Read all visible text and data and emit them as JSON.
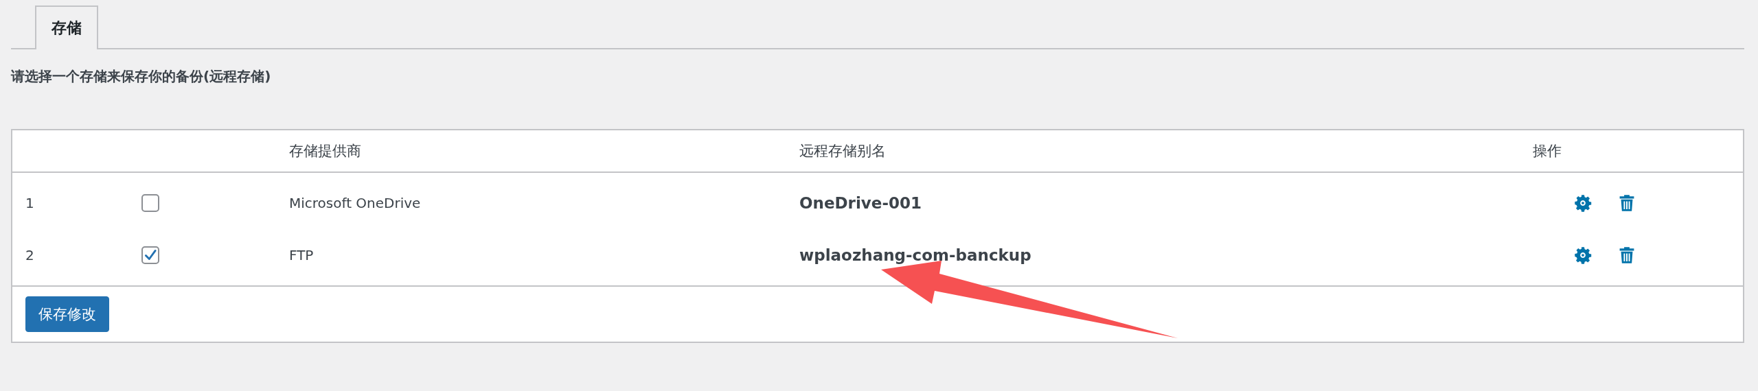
{
  "tabs": [
    {
      "label": "存储",
      "selected": true
    }
  ],
  "description": "请选择一个存储来保存你的备份(远程存储)",
  "table": {
    "headers": {
      "provider": "存储提供商",
      "alias": "远程存储别名",
      "actions": "操作"
    },
    "rows": [
      {
        "index": "1",
        "checked": false,
        "provider": "Microsoft OneDrive",
        "alias": "OneDrive-001"
      },
      {
        "index": "2",
        "checked": true,
        "provider": "FTP",
        "alias": "wplaozhang-com-banckup"
      }
    ],
    "save_button": "保存修改"
  },
  "annotation": {
    "kind": "arrow"
  }
}
